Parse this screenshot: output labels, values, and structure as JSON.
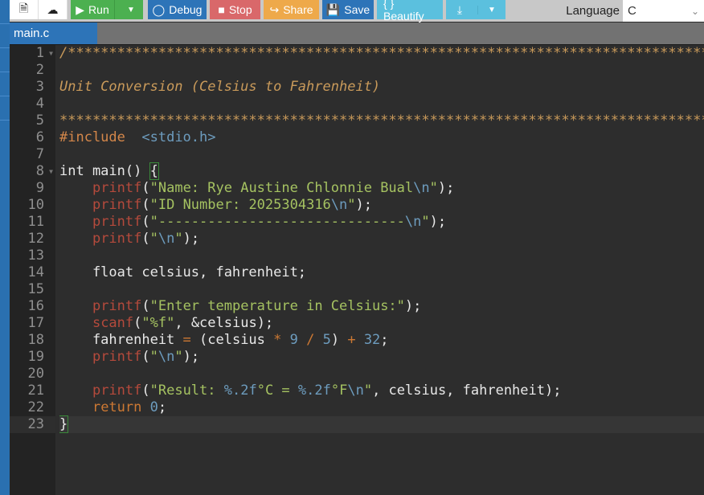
{
  "toolbar": {
    "new_icon": "file-icon",
    "upload_icon": "cloud-upload-icon",
    "run": "Run",
    "debug": "Debug",
    "stop": "Stop",
    "share": "Share",
    "save": "Save",
    "beautify": "{ } Beautify",
    "download_icon": "download-icon",
    "language_label": "Language",
    "language_value": "C"
  },
  "tab": {
    "label": "main.c"
  },
  "editor": {
    "current_line": 23,
    "lines": [
      [
        [
          "comment",
          "/*****************************************************************************************************"
        ]
      ],
      [],
      [
        [
          "comment",
          "Unit Conversion (Celsius to Fahrenheit)"
        ]
      ],
      [],
      [
        [
          "comment",
          "*****************************************************************************************************"
        ]
      ],
      [
        [
          "pp",
          "#include"
        ],
        [
          "",
          "  "
        ],
        [
          "hdr",
          "<stdio.h>"
        ]
      ],
      [],
      [
        [
          "",
          "int main() "
        ],
        [
          "brace",
          "{"
        ]
      ],
      [
        [
          "",
          "    "
        ],
        [
          "fn",
          "printf"
        ],
        [
          "",
          "("
        ],
        [
          "str",
          "\"Name: Rye Austine Chlonnie Bual"
        ],
        [
          "esc",
          "\\n"
        ],
        [
          "str",
          "\""
        ],
        [
          "",
          ");"
        ]
      ],
      [
        [
          "",
          "    "
        ],
        [
          "fn",
          "printf"
        ],
        [
          "",
          "("
        ],
        [
          "str",
          "\"ID Number: 2025304316"
        ],
        [
          "esc",
          "\\n"
        ],
        [
          "str",
          "\""
        ],
        [
          "",
          ");"
        ]
      ],
      [
        [
          "",
          "    "
        ],
        [
          "fn",
          "printf"
        ],
        [
          "",
          "("
        ],
        [
          "str",
          "\"------------------------------"
        ],
        [
          "esc",
          "\\n"
        ],
        [
          "str",
          "\""
        ],
        [
          "",
          ");"
        ]
      ],
      [
        [
          "",
          "    "
        ],
        [
          "fn",
          "printf"
        ],
        [
          "",
          "("
        ],
        [
          "str",
          "\""
        ],
        [
          "esc",
          "\\n"
        ],
        [
          "str",
          "\""
        ],
        [
          "",
          ");"
        ]
      ],
      [],
      [
        [
          "",
          "    float celsius, fahrenheit;"
        ]
      ],
      [],
      [
        [
          "",
          "    "
        ],
        [
          "fn",
          "printf"
        ],
        [
          "",
          "("
        ],
        [
          "str",
          "\"Enter temperature in Celsius:\""
        ],
        [
          "",
          ");"
        ]
      ],
      [
        [
          "",
          "    "
        ],
        [
          "fn",
          "scanf"
        ],
        [
          "",
          "("
        ],
        [
          "str",
          "\"%f\""
        ],
        [
          "",
          ", &celsius);"
        ]
      ],
      [
        [
          "",
          "    fahrenheit "
        ],
        [
          "op",
          "="
        ],
        [
          "",
          " (celsius "
        ],
        [
          "op",
          "*"
        ],
        [
          "",
          ""
        ],
        [
          "num",
          " 9"
        ],
        [
          "op",
          " /"
        ],
        [
          "num",
          " 5"
        ],
        [
          "",
          ") "
        ],
        [
          "op",
          "+"
        ],
        [
          "num",
          " 32"
        ],
        [
          "",
          ";"
        ]
      ],
      [
        [
          "",
          "    "
        ],
        [
          "fn",
          "printf"
        ],
        [
          "",
          "("
        ],
        [
          "str",
          "\""
        ],
        [
          "esc",
          "\\n"
        ],
        [
          "str",
          "\""
        ],
        [
          "",
          ");"
        ]
      ],
      [],
      [
        [
          "",
          "    "
        ],
        [
          "fn",
          "printf"
        ],
        [
          "",
          "("
        ],
        [
          "str",
          "\"Result: "
        ],
        [
          "esc",
          "%.2f"
        ],
        [
          "str",
          "°C = "
        ],
        [
          "esc",
          "%.2f"
        ],
        [
          "str",
          "°F"
        ],
        [
          "esc",
          "\\n"
        ],
        [
          "str",
          "\""
        ],
        [
          "",
          ", celsius, fahrenheit);"
        ]
      ],
      [
        [
          "",
          "    "
        ],
        [
          "kw",
          "return"
        ],
        [
          "num",
          " 0"
        ],
        [
          "",
          ";"
        ]
      ],
      [
        [
          "brace",
          "}"
        ]
      ]
    ]
  }
}
